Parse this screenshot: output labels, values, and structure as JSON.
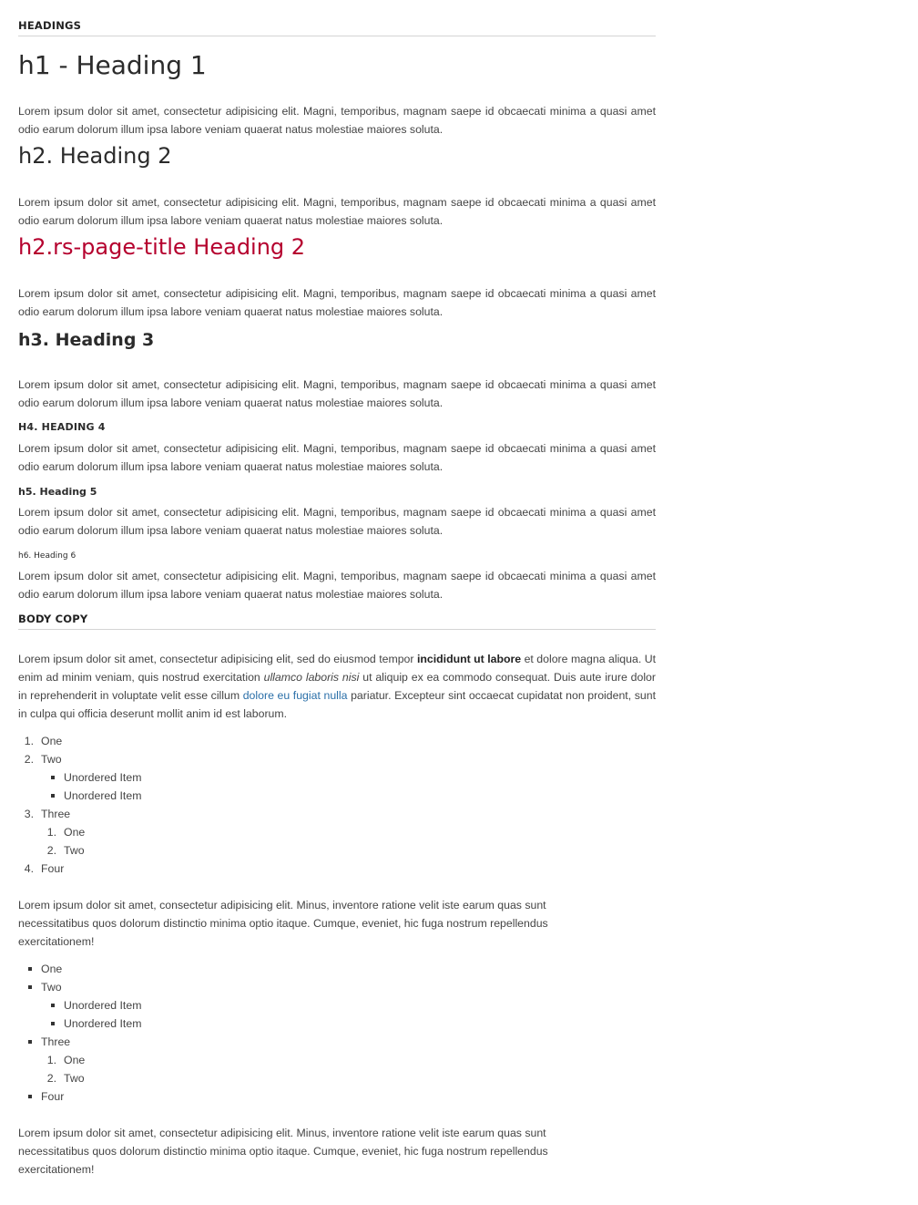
{
  "headings_section": {
    "title": "HEADINGS",
    "h1": "h1 - Heading 1",
    "h2": "h2. Heading 2",
    "h2_page_title": "h2.rs-page-title Heading 2",
    "h3": "h3. Heading 3",
    "h4": "H4. HEADING 4",
    "h5": "h5. Heading 5",
    "h6": "h6. Heading 6",
    "lorem": "Lorem ipsum dolor sit amet, consectetur adipisicing elit. Magni, temporibus, magnam saepe id obcaecati minima a quasi amet odio earum dolorum illum ipsa labore veniam quaerat natus molestiae maiores soluta."
  },
  "body_copy": {
    "title": "BODY COPY",
    "paragraph": {
      "part1": "Lorem ipsum dolor sit amet, consectetur adipisicing elit, sed do eiusmod tempor ",
      "bold": "incididunt ut labore",
      "part2": " et dolore magna aliqua. Ut enim ad minim veniam, quis nostrud exercitation ",
      "italic": "ullamco laboris nisi",
      "part3": " ut aliquip ex ea commodo consequat. Duis aute irure dolor in reprehenderit in voluptate velit esse cillum ",
      "link": "dolore eu fugiat nulla",
      "part4": " pariatur. Excepteur sint occaecat cupidatat non proident, sunt in culpa qui officia deserunt mollit anim id est laborum."
    },
    "ordered_list": {
      "items": [
        "One",
        "Two",
        "Three",
        "Four"
      ],
      "markers": [
        "1.",
        "2.",
        "3.",
        "4."
      ],
      "sub_unordered": [
        "Unordered Item",
        "Unordered Item"
      ],
      "sub_ordered": [
        "One",
        "Two"
      ],
      "sub_ordered_markers": [
        "1.",
        "2."
      ]
    },
    "paragraph2": "Lorem ipsum dolor sit amet, consectetur adipisicing elit. Minus, inventore ratione velit iste earum quas sunt necessitatibus quos dolorum distinctio minima optio itaque. Cumque, eveniet, hic fuga nostrum repellendus exercitationem!",
    "unordered_list": {
      "items": [
        "One",
        "Two",
        "Three",
        "Four"
      ],
      "sub_unordered": [
        "Unordered Item",
        "Unordered Item"
      ],
      "sub_ordered": [
        "One",
        "Two"
      ],
      "sub_ordered_markers": [
        "1.",
        "2."
      ]
    },
    "paragraph3": "Lorem ipsum dolor sit amet, consectetur adipisicing elit. Minus, inventore ratione velit iste earum quas sunt necessitatibus quos dolorum distinctio minima optio itaque. Cumque, eveniet, hic fuga nostrum repellendus exercitationem!"
  },
  "colors": {
    "page_title_red": "#b5002e",
    "link_blue": "#2a6fa8"
  }
}
